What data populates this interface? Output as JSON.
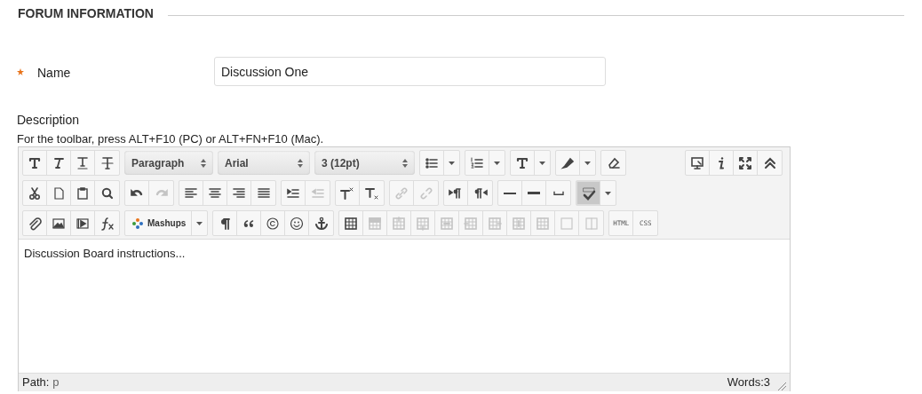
{
  "section_title": "FORUM INFORMATION",
  "name_field": {
    "required": true,
    "label": "Name",
    "value": "Discussion One"
  },
  "description": {
    "label": "Description",
    "hint": "For the toolbar, press ALT+F10 (PC) or ALT+FN+F10 (Mac)."
  },
  "toolbar": {
    "rows": [
      {
        "groups": [
          {
            "buttons": [
              {
                "kind": "icon",
                "disabled": false
              },
              {
                "kind": "icon",
                "disabled": false
              },
              {
                "kind": "icon",
                "disabled": false
              },
              {
                "kind": "icon",
                "disabled": false
              }
            ]
          },
          {
            "buttons": [
              {
                "kind": "select",
                "value": "Paragraph"
              }
            ]
          },
          {
            "buttons": [
              {
                "kind": "select",
                "value": "Arial"
              }
            ]
          },
          {
            "buttons": [
              {
                "kind": "select",
                "value": "3 (12pt)"
              }
            ]
          },
          {
            "buttons": [
              {
                "kind": "split",
                "disabled": false
              }
            ]
          },
          {
            "buttons": [
              {
                "kind": "split",
                "disabled": false
              }
            ]
          },
          {
            "buttons": [
              {
                "kind": "split",
                "disabled": false
              }
            ]
          },
          {
            "buttons": [
              {
                "kind": "split",
                "disabled": false
              }
            ]
          },
          {
            "buttons": [
              {
                "kind": "icon",
                "disabled": false
              }
            ]
          }
        ],
        "end_groups": [
          {
            "buttons": [
              {
                "kind": "icon",
                "disabled": false
              },
              {
                "kind": "icon",
                "disabled": false
              },
              {
                "kind": "icon",
                "disabled": false
              },
              {
                "kind": "icon",
                "disabled": false
              }
            ]
          }
        ]
      },
      {
        "groups": [
          {
            "buttons": [
              {
                "kind": "icon",
                "disabled": false
              },
              {
                "kind": "icon",
                "disabled": false
              },
              {
                "kind": "icon",
                "disabled": false
              },
              {
                "kind": "icon",
                "disabled": false
              }
            ]
          },
          {
            "buttons": [
              {
                "kind": "icon",
                "disabled": false
              },
              {
                "kind": "icon",
                "disabled": true
              }
            ]
          },
          {
            "buttons": [
              {
                "kind": "icon",
                "disabled": false
              },
              {
                "kind": "icon",
                "disabled": false
              },
              {
                "kind": "icon",
                "disabled": false
              },
              {
                "kind": "icon",
                "disabled": false
              }
            ]
          },
          {
            "buttons": [
              {
                "kind": "icon",
                "disabled": false
              },
              {
                "kind": "icon",
                "disabled": true
              }
            ]
          },
          {
            "buttons": [
              {
                "kind": "icon",
                "disabled": false
              },
              {
                "kind": "icon",
                "disabled": false
              }
            ]
          },
          {
            "buttons": [
              {
                "kind": "icon",
                "disabled": true
              },
              {
                "kind": "icon",
                "disabled": true
              }
            ]
          },
          {
            "buttons": [
              {
                "kind": "icon",
                "disabled": false
              },
              {
                "kind": "icon",
                "disabled": false
              }
            ]
          },
          {
            "buttons": [
              {
                "kind": "icon",
                "disabled": false
              },
              {
                "kind": "icon",
                "disabled": false
              },
              {
                "kind": "icon",
                "disabled": false
              }
            ]
          },
          {
            "buttons": [
              {
                "kind": "split",
                "disabled": false,
                "selected": true
              }
            ]
          }
        ]
      },
      {
        "groups": [
          {
            "buttons": [
              {
                "kind": "icon",
                "disabled": false
              },
              {
                "kind": "icon",
                "disabled": false
              },
              {
                "kind": "icon",
                "disabled": false
              },
              {
                "kind": "icon",
                "disabled": false
              }
            ]
          },
          {
            "buttons": [
              {
                "kind": "split",
                "disabled": false,
                "label": "Mashups"
              }
            ]
          },
          {
            "buttons": [
              {
                "kind": "icon",
                "disabled": false
              },
              {
                "kind": "icon",
                "disabled": false
              },
              {
                "kind": "icon",
                "disabled": false
              },
              {
                "kind": "icon",
                "disabled": false
              },
              {
                "kind": "icon",
                "disabled": false
              }
            ]
          },
          {
            "buttons": [
              {
                "kind": "icon",
                "disabled": false
              },
              {
                "kind": "icon",
                "disabled": true
              },
              {
                "kind": "icon",
                "disabled": true
              },
              {
                "kind": "icon",
                "disabled": true
              },
              {
                "kind": "icon",
                "disabled": true
              },
              {
                "kind": "icon",
                "disabled": true
              },
              {
                "kind": "icon",
                "disabled": true
              },
              {
                "kind": "icon",
                "disabled": true
              },
              {
                "kind": "icon",
                "disabled": true
              },
              {
                "kind": "icon",
                "disabled": true
              },
              {
                "kind": "icon",
                "disabled": true
              }
            ]
          },
          {
            "buttons": [
              {
                "kind": "text",
                "label": "HTML"
              },
              {
                "kind": "text",
                "label": "CSS"
              }
            ]
          }
        ]
      }
    ]
  },
  "content": "Discussion Board instructions...",
  "status_bar": {
    "path_label": "Path:",
    "path": "p",
    "word_count": "Words:3"
  }
}
